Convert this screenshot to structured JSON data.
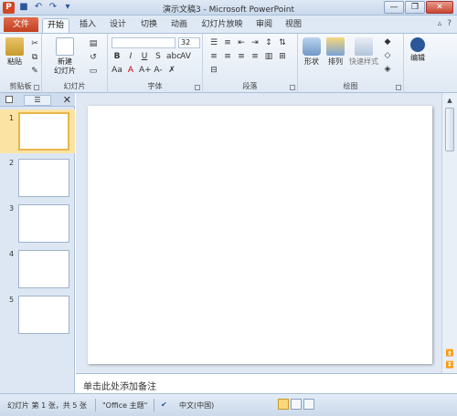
{
  "titlebar": {
    "app_icon": "P",
    "title": "演示文稿3 - Microsoft PowerPoint",
    "qat_icons": [
      "save-icon",
      "undo-icon",
      "redo-icon",
      "customize-icon"
    ]
  },
  "tabs": {
    "file": "文件",
    "items": [
      "开始",
      "插入",
      "设计",
      "切换",
      "动画",
      "幻灯片放映",
      "审阅",
      "视图"
    ],
    "active": "开始"
  },
  "ribbon": {
    "clipboard": {
      "paste": "粘贴",
      "label": "剪贴板"
    },
    "slides": {
      "new_slide_line1": "新建",
      "new_slide_line2": "幻灯片",
      "label": "幻灯片"
    },
    "font": {
      "size": "32",
      "label": "字体"
    },
    "paragraph": {
      "label": "段落"
    },
    "drawing": {
      "shapes": "形状",
      "arrange": "排列",
      "quick_styles": "快速样式",
      "label": "绘图"
    },
    "editing": {
      "edit": "编辑"
    }
  },
  "left_panel": {
    "slides": [
      {
        "num": "1"
      },
      {
        "num": "2"
      },
      {
        "num": "3"
      },
      {
        "num": "4"
      },
      {
        "num": "5"
      }
    ]
  },
  "notes": {
    "placeholder": "单击此处添加备注"
  },
  "status": {
    "slide_info": "幻灯片 第 1 张，共 5 张",
    "theme": "\"Office 主题\"",
    "language": "中文(中国)"
  },
  "colors": {
    "file_tab": "#c2401f",
    "selected_thumb": "#fbe3a3",
    "ribbon_bg": "#dfe8f3"
  }
}
